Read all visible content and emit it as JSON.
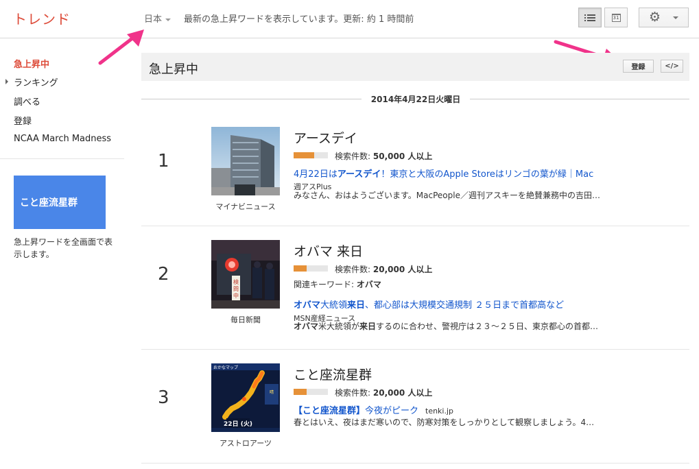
{
  "header": {
    "logo": "トレンド",
    "region": "日本",
    "status": "最新の急上昇ワードを表示しています。更新: 約 1 時間前",
    "calendar_day": "31"
  },
  "sidebar": {
    "items": [
      {
        "label": "急上昇中"
      },
      {
        "label": "ランキング"
      },
      {
        "label": "調べる"
      },
      {
        "label": "登録"
      },
      {
        "label": "NCAA March Madness"
      }
    ],
    "tile_label": "こと座流星群",
    "tile_caption": "急上昇ワードを全画面で表示します。"
  },
  "main": {
    "section_title": "急上昇中",
    "subscribe_label": "登録",
    "embed_label": "</>",
    "date": "2014年4月22日火曜日"
  },
  "trends": [
    {
      "rank": "1",
      "title": "アースデイ",
      "searches_label": "検索件数:",
      "searches_value": "50,000 人以上",
      "volume_fraction": 0.6,
      "image_source": "マイナビニュース",
      "headline_pre": "4月22日は",
      "headline_bold": "アースデイ",
      "headline_post": "！東京と大阪のApple Storeはリンゴの葉が緑｜Mac",
      "news_source": "週アスPlus",
      "snippet": "みなさん、おはようございます。MacPeople／週刊アスキーを絶賛兼務中の吉田…"
    },
    {
      "rank": "2",
      "title": "オバマ 来日",
      "searches_label": "検索件数:",
      "searches_value": "20,000 人以上",
      "volume_fraction": 0.38,
      "image_source": "毎日新聞",
      "related_label": "関連キーワード:",
      "related_value": "オバマ",
      "headline_bold1": "オバマ",
      "headline_mid1": "大統領",
      "headline_bold2": "来日",
      "headline_post": "、都心部は大規模交通規制 ２５日まで首都高など",
      "news_source": "MSN産経ニュース",
      "snippet_bold1": "オバマ",
      "snippet_mid1": "米大統領が",
      "snippet_bold2": "来日",
      "snippet_post": "するのに合わせ、警視庁は２３～２５日、東京都心の首都…"
    },
    {
      "rank": "3",
      "title": "こと座流星群",
      "searches_label": "検索件数:",
      "searches_value": "20,000 人以上",
      "volume_fraction": 0.38,
      "image_source": "アストロアーツ",
      "headline_bold": "【こと座流星群】",
      "headline_post": "今夜がピーク",
      "news_source": "tenki.jp",
      "snippet": "春とはいえ、夜はまだ寒いので、防寒対策をしっかりとして観察しましょう。4…",
      "thumb_caption": "22日 (火)",
      "thumb_header": "おかなマップ"
    }
  ],
  "colors": {
    "brand_red": "#dd4b39",
    "link_blue": "#1155cc",
    "meter_orange": "#e69138",
    "tile_blue": "#4a86e8",
    "annotation_pink": "#f0338a"
  }
}
